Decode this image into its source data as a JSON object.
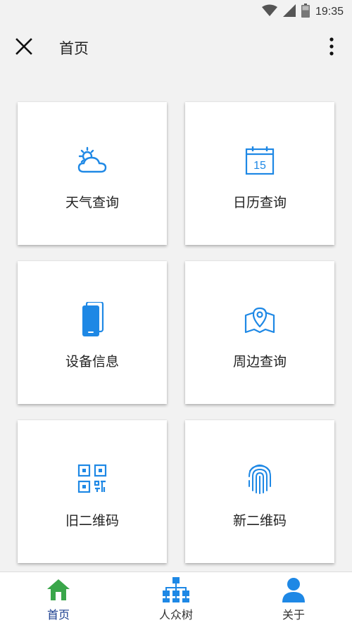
{
  "status_bar": {
    "time": "19:35",
    "icons": [
      "wifi-icon",
      "signal-icon",
      "battery-icon"
    ]
  },
  "toolbar": {
    "close_icon": "close-icon",
    "title": "首页",
    "more_icon": "more-vert-icon"
  },
  "grid": {
    "items": [
      {
        "label": "天气查询",
        "icon": "weather-icon"
      },
      {
        "label": "日历查询",
        "icon": "calendar-icon",
        "icon_text": "15"
      },
      {
        "label": "设备信息",
        "icon": "phone-icon"
      },
      {
        "label": "周边查询",
        "icon": "map-pin-icon"
      },
      {
        "label": "旧二维码",
        "icon": "qr-code-icon"
      },
      {
        "label": "新二维码",
        "icon": "fingerprint-icon"
      }
    ]
  },
  "bottom_nav": {
    "items": [
      {
        "label": "首页",
        "icon": "home-icon",
        "active": true
      },
      {
        "label": "人众树",
        "icon": "tree-icon",
        "active": false
      },
      {
        "label": "关于",
        "icon": "user-icon",
        "active": false
      }
    ]
  },
  "colors": {
    "icon_blue": "#1e88e5",
    "home_green": "#3aa64a",
    "nav_blue": "#1e88e5",
    "background": "#f2f2f2"
  }
}
